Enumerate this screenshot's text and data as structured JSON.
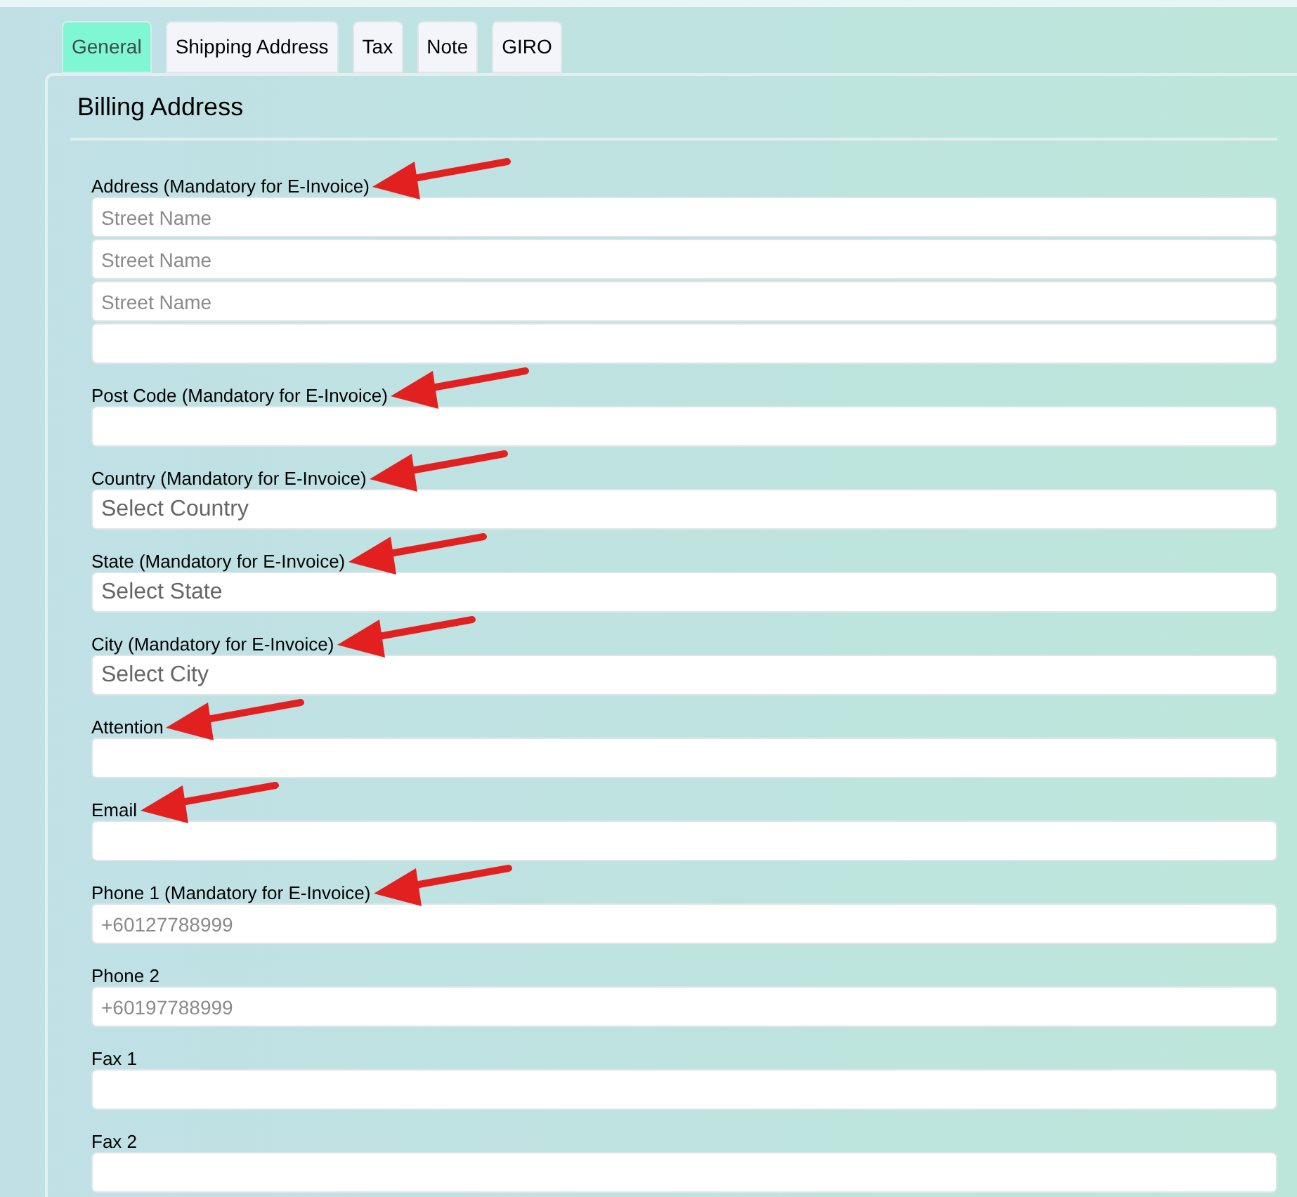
{
  "tabs": [
    {
      "label": "General",
      "selected": true
    },
    {
      "label": "Shipping Address",
      "selected": false
    },
    {
      "label": "Tax",
      "selected": false
    },
    {
      "label": "Note",
      "selected": false
    },
    {
      "label": "GIRO",
      "selected": false
    }
  ],
  "section": {
    "title": "Billing Address"
  },
  "fields": [
    {
      "label": "Address (Mandatory for E-Invoice)",
      "annotated": true,
      "inputs": [
        {
          "kind": "text",
          "placeholder": "Street Name"
        },
        {
          "kind": "text",
          "placeholder": "Street Name"
        },
        {
          "kind": "text",
          "placeholder": "Street Name"
        },
        {
          "kind": "text"
        }
      ]
    },
    {
      "label": "Post Code (Mandatory for E-Invoice)",
      "annotated": true,
      "inputs": [
        {
          "kind": "text"
        }
      ]
    },
    {
      "label": "Country (Mandatory for E-Invoice)",
      "annotated": true,
      "inputs": [
        {
          "kind": "select",
          "placeholder": "Select Country"
        }
      ]
    },
    {
      "label": "State (Mandatory for E-Invoice)",
      "annotated": true,
      "inputs": [
        {
          "kind": "select",
          "placeholder": "Select State"
        }
      ]
    },
    {
      "label": "City (Mandatory for E-Invoice)",
      "annotated": true,
      "inputs": [
        {
          "kind": "select",
          "placeholder": "Select City"
        }
      ]
    },
    {
      "label": "Attention",
      "annotated": true,
      "inputs": [
        {
          "kind": "text"
        }
      ]
    },
    {
      "label": "Email",
      "annotated": true,
      "inputs": [
        {
          "kind": "text"
        }
      ]
    },
    {
      "label": "Phone 1 (Mandatory for E-Invoice)",
      "annotated": true,
      "inputs": [
        {
          "kind": "text",
          "placeholder": "+60127788999"
        }
      ]
    },
    {
      "label": "Phone 2",
      "annotated": false,
      "inputs": [
        {
          "kind": "text",
          "placeholder": "+60197788999"
        }
      ]
    },
    {
      "label": "Fax 1",
      "annotated": false,
      "inputs": [
        {
          "kind": "text"
        }
      ]
    },
    {
      "label": "Fax 2",
      "annotated": false,
      "inputs": [
        {
          "kind": "text"
        }
      ]
    }
  ]
}
